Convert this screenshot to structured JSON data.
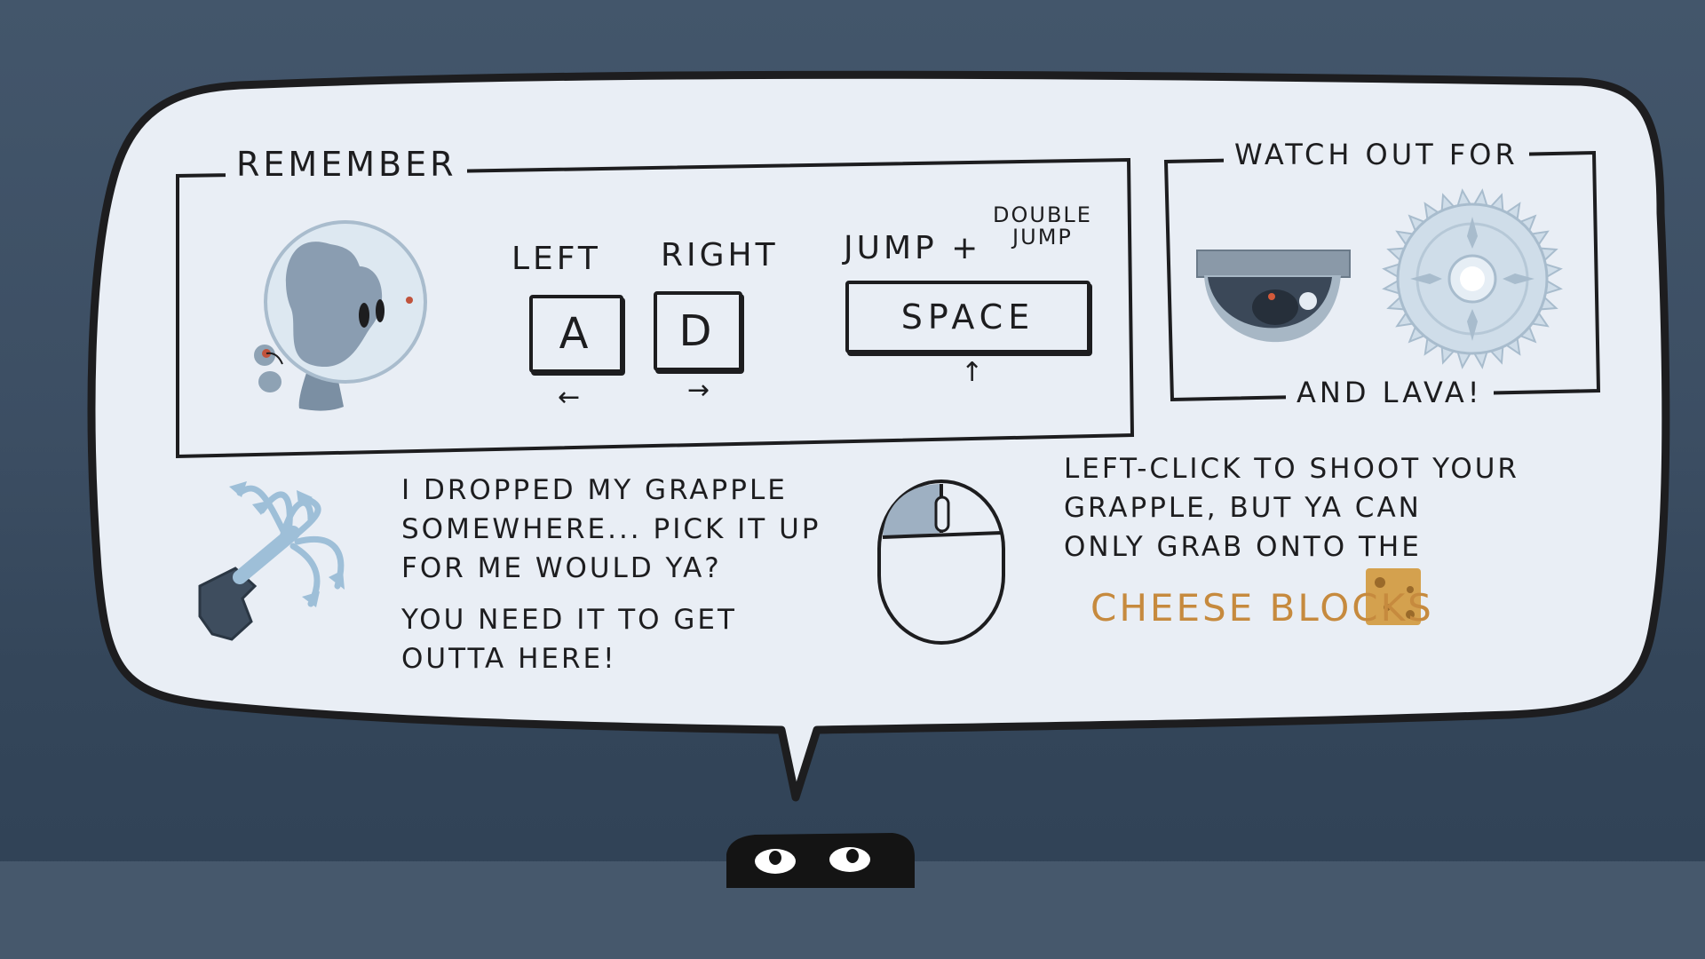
{
  "colors": {
    "background": "#3c4e63",
    "ground": "#46586c",
    "bubble_fill": "#e9eef5",
    "outline": "#1d1d1f",
    "accent_blue": "#9ebfd8",
    "cheese": "#d4a14e",
    "cheese_text": "#c68a3e"
  },
  "remember_box": {
    "title": "REMEMBER",
    "character_icon": "astronaut-blob-icon",
    "left_label": "LEFT",
    "right_label": "RIGHT",
    "jump_label": "JUMP +",
    "double_jump_label_line1": "DOUBLE",
    "double_jump_label_line2": "JUMP",
    "key_left": "A",
    "key_right": "D",
    "key_jump": "SPACE",
    "arrow_left": "←",
    "arrow_right": "→",
    "arrow_up": "↑"
  },
  "watch_box": {
    "title": "WATCH OUT FOR",
    "footer": "AND LAVA!",
    "hazard_icons": [
      "security-camera-icon",
      "spinning-sawblade-icon"
    ]
  },
  "grapple_section": {
    "icon": "grapple-hook-icon",
    "line1": "I DROPPED MY GRAPPLE",
    "line2": "SOMEWHERE... PICK IT UP",
    "line3": "FOR ME WOULD YA?",
    "line4": "YOU NEED IT TO GET",
    "line5": "OUTTA HERE!"
  },
  "mouse_section": {
    "icon": "mouse-left-click-icon",
    "line1": "LEFT-CLICK TO SHOOT YOUR",
    "line2": "GRAPPLE, BUT YA CAN",
    "line3": "ONLY GRAB ONTO THE",
    "highlight": "CHEESE BLOCKS",
    "block_icon": "cheese-block-icon"
  },
  "speaker": {
    "icon": "shadow-creature-eyes-icon"
  }
}
